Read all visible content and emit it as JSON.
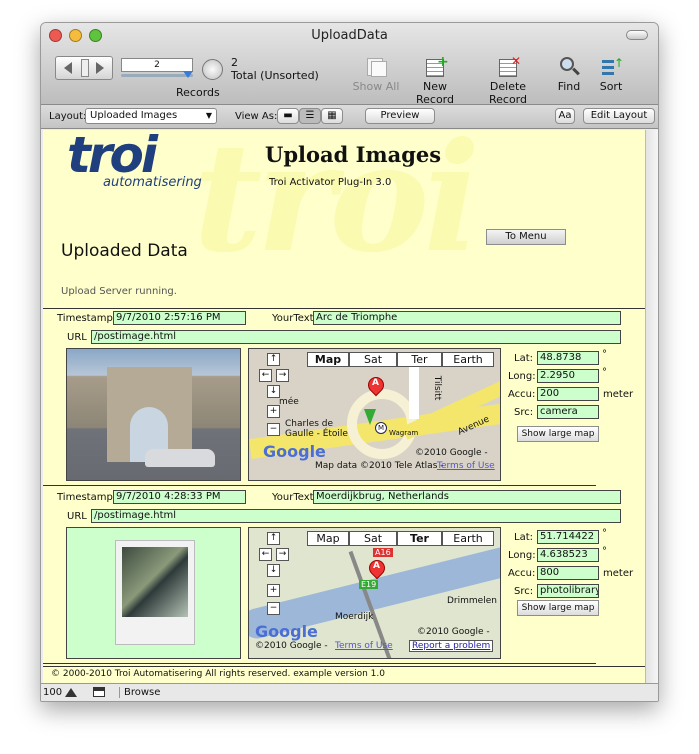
{
  "window": {
    "title": "UploadData"
  },
  "toolbar": {
    "record_number": "2",
    "records_label": "Records",
    "total_count": "2",
    "total_label": "Total (Unsorted)",
    "show_all": "Show All",
    "new_record": "New Record",
    "delete_record": "Delete Record",
    "find": "Find",
    "sort": "Sort"
  },
  "layoutbar": {
    "layout_label": "Layout:",
    "layout_value": "Uploaded Images",
    "view_as_label": "View As:",
    "preview": "Preview",
    "font_btn": "Aa",
    "edit_layout": "Edit Layout"
  },
  "header": {
    "logo_main": "troi",
    "logo_sub": "automatisering",
    "title": "Upload Images",
    "subtitle": "Troi Activator Plug-In 3.0",
    "to_menu": "To Menu",
    "section_title": "Uploaded Data",
    "status": "Upload Server running."
  },
  "labels": {
    "timestamp": "Timestamp",
    "yourtext": "YourText",
    "url": "URL",
    "lat": "Lat:",
    "long": "Long:",
    "accu": "Accu:",
    "src": "Src:",
    "degree": "°",
    "meter": "meter",
    "show_large_map": "Show large map"
  },
  "map_tabs": [
    "Map",
    "Sat",
    "Ter",
    "Earth"
  ],
  "records": [
    {
      "timestamp": "9/7/2010 2:57:16 PM",
      "yourtext": "Arc de Triomphe",
      "url": "/postimage.html",
      "lat": "48.8738",
      "long": "2.2950",
      "accu": "200",
      "src": "camera",
      "active_tab": "Map",
      "map_labels": {
        "a": "Charles de Gaulle - Étoile",
        "b": "Avenue",
        "c": "Tilsitt",
        "d": "mée",
        "e": "Wagram"
      },
      "copyright": "©2010 Google -",
      "mapdata": "Map data ©2010 Tele Atlas -",
      "terms": "Terms of Use",
      "marker": "A",
      "report": ""
    },
    {
      "timestamp": "9/7/2010 4:28:33 PM",
      "yourtext": "Moerdijkbrug, Netherlands",
      "url": "/postimage.html",
      "lat": "51.714422",
      "long": "4.638523",
      "accu": "800",
      "src": "photolibrary",
      "active_tab": "Ter",
      "map_labels": {
        "a": "Drimmelen",
        "b": "Moerdijk",
        "c": "A16",
        "d": "E19",
        "e": ""
      },
      "copyright": "©2010 Google -",
      "mapdata": "©2010 Google -",
      "terms": "Terms of Use",
      "marker": "A",
      "report": "Report a problem"
    }
  ],
  "footer": {
    "copyright": "© 2000-2010 Troi Automatisering  All rights reserved. example version 1.0"
  },
  "statusbar": {
    "zoom": "100",
    "mode": "Browse"
  }
}
